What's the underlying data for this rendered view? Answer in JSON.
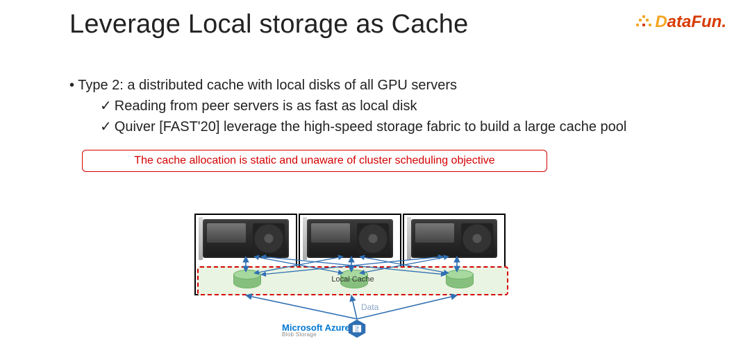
{
  "title": "Leverage Local storage as Cache",
  "logo": {
    "d": "D",
    "rest": "ataFun."
  },
  "bullets": {
    "l1": "Type 2: a distributed cache with local disks of all GPU servers",
    "l2a": "Reading from peer servers is as fast as local disk",
    "l2b": "Quiver [FAST'20] leverage the high-speed storage fabric to build a large cache pool"
  },
  "callout": "The cache allocation is static and unaware of cluster scheduling objective",
  "diagram": {
    "cache_label": "Local Cache",
    "data_label": "Data",
    "azure_main": "Microsoft Azure",
    "azure_sub": "Blob Storage",
    "hex_text": "10 01"
  }
}
